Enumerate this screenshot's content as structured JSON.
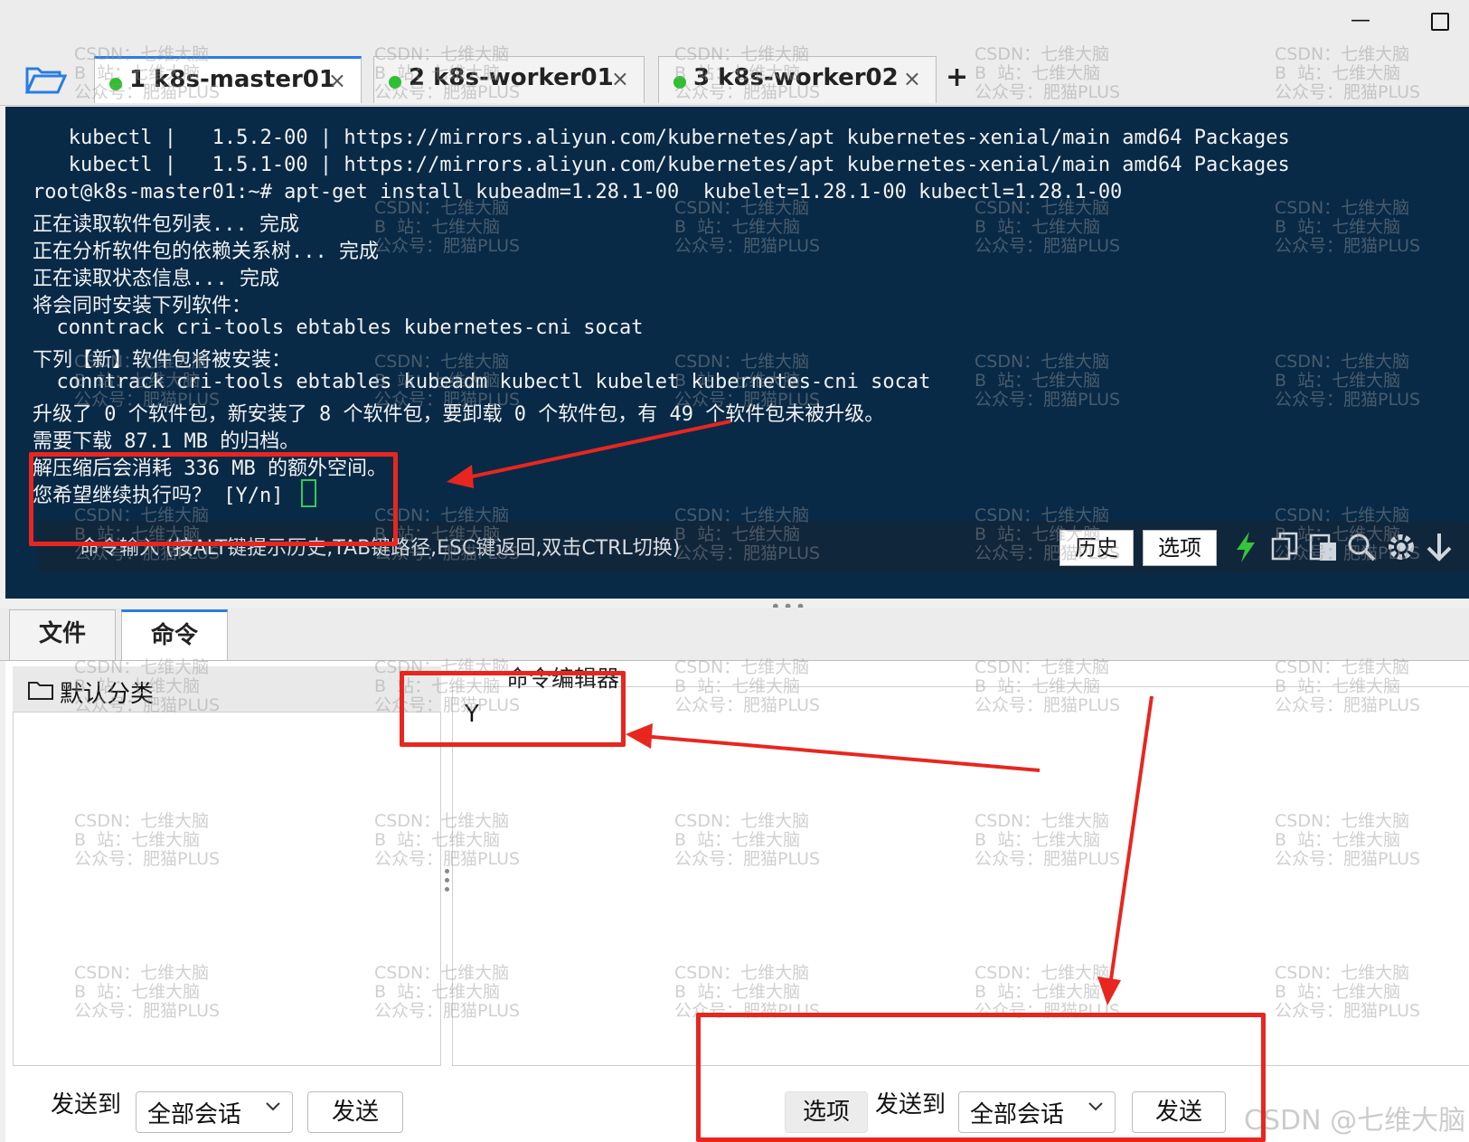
{
  "tabs": [
    {
      "label": "1 k8s-master01",
      "active": true
    },
    {
      "label": "2 k8s-worker01",
      "active": false
    },
    {
      "label": "3 k8s-worker02",
      "active": false
    }
  ],
  "tab_add": "+",
  "tab_close": "×",
  "terminal": {
    "lines": [
      "   kubectl |   1.5.2-00 | https://mirrors.aliyun.com/kubernetes/apt kubernetes-xenial/main amd64 Packages",
      "   kubectl |   1.5.1-00 | https://mirrors.aliyun.com/kubernetes/apt kubernetes-xenial/main amd64 Packages",
      "root@k8s-master01:~# apt-get install kubeadm=1.28.1-00  kubelet=1.28.1-00 kubectl=1.28.1-00",
      "正在读取软件包列表... 完成",
      "正在分析软件包的依赖关系树... 完成",
      "正在读取状态信息... 完成",
      "将会同时安装下列软件：",
      "  conntrack cri-tools ebtables kubernetes-cni socat",
      "下列【新】软件包将被安装：",
      "  conntrack cri-tools ebtables kubeadm kubectl kubelet kubernetes-cni socat",
      "升级了 0 个软件包，新安装了 8 个软件包，要卸载 0 个软件包，有 49 个软件包未被升级。",
      "需要下载 87.1 MB 的归档。",
      "解压缩后会消耗 336 MB 的额外空间。",
      "您希望继续执行吗？ [Y/n] "
    ],
    "command_placeholder": "命令输入 (按ALT键提示历史,TAB键路径,ESC键返回,双击CTRL切换)",
    "history_button": "历史",
    "options_button": "选项"
  },
  "panel_tabs": [
    "文件",
    "命令"
  ],
  "command_panel": {
    "category": "默认分类",
    "editor_title": "命令编辑器",
    "editor_text": "Y",
    "send_to_label": "发送到",
    "send_target": "全部会话",
    "send_button": "发送",
    "options_button": "选项"
  },
  "watermark": {
    "line1": "CSDN：七维大脑",
    "line2": "B  站：七维大脑",
    "line3": "公众号：肥猫PLUS",
    "corner": "CSDN @七维大脑"
  },
  "colors": {
    "terminal_bg": "#082a47",
    "accent_blue": "#2a7de1",
    "session_green": "#2ec02e",
    "annotation_red": "#e8261f"
  }
}
